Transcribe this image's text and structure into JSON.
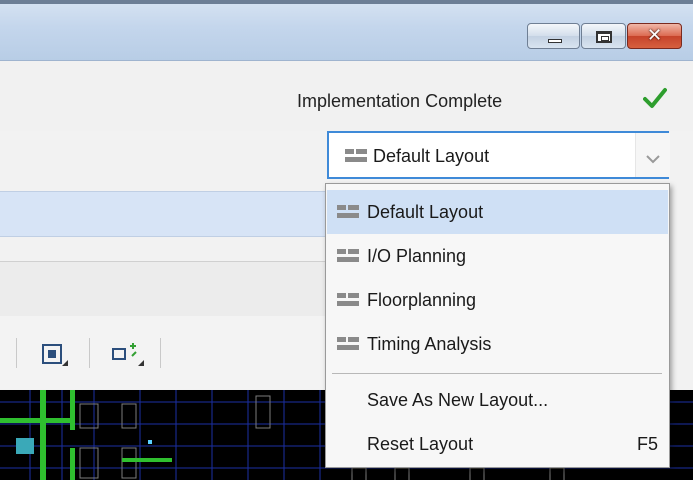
{
  "window": {
    "controls": {
      "minimize": "minimize-icon",
      "maximize": "maximize-icon",
      "close": "close-icon",
      "close_glyph": "✕"
    },
    "colors": {
      "accent": "#3f8ad8",
      "selected": "#cfe0f5",
      "success": "#2e9e2e"
    }
  },
  "status": {
    "text": "Implementation Complete",
    "icon": "checkmark-icon"
  },
  "layout_select": {
    "value": "Default Layout",
    "icon": "layout-icon",
    "arrow_icon": "chevron-down-icon"
  },
  "menu": {
    "items": [
      {
        "label": "Default Layout",
        "icon": "layout-icon",
        "selected": true
      },
      {
        "label": "I/O Planning",
        "icon": "layout-icon"
      },
      {
        "label": "Floorplanning",
        "icon": "layout-icon"
      },
      {
        "label": "Timing Analysis",
        "icon": "layout-icon"
      }
    ],
    "actions": [
      {
        "label": "Save As New Layout..."
      },
      {
        "label": "Reset Layout",
        "shortcut": "F5"
      }
    ]
  },
  "toolbar": {
    "icons": [
      "fit-selection-icon",
      "auto-fit-icon"
    ]
  }
}
